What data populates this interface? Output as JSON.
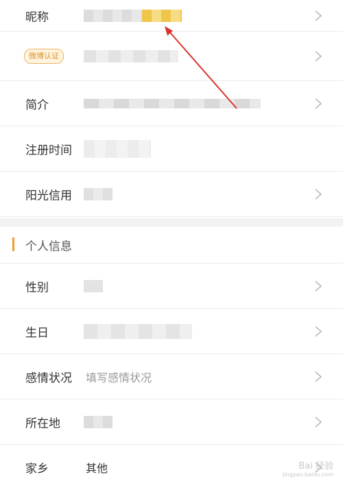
{
  "profile": {
    "rows": [
      {
        "key": "nickname",
        "label": "昵称"
      },
      {
        "key": "weibo_verify",
        "badge": "微博认证"
      },
      {
        "key": "intro",
        "label": "简介"
      },
      {
        "key": "register_time",
        "label": "注册时间"
      },
      {
        "key": "sunshine_credit",
        "label": "阳光信用"
      }
    ]
  },
  "personal_info": {
    "title": "个人信息",
    "rows": [
      {
        "key": "gender",
        "label": "性别"
      },
      {
        "key": "birthday",
        "label": "生日"
      },
      {
        "key": "relationship",
        "label": "感情状况",
        "placeholder": "填写感情状况"
      },
      {
        "key": "location",
        "label": "所在地"
      },
      {
        "key": "hometown",
        "label": "家乡",
        "value": "其他"
      }
    ]
  },
  "watermark": {
    "text": "Bai 经验",
    "sub": "jingyan.baidu.com"
  },
  "colors": {
    "accent": "#f29a2e",
    "annotation_arrow": "#d9342b",
    "badge": "#d9962f"
  },
  "icons": {
    "chevron": "chevron-right-icon"
  }
}
